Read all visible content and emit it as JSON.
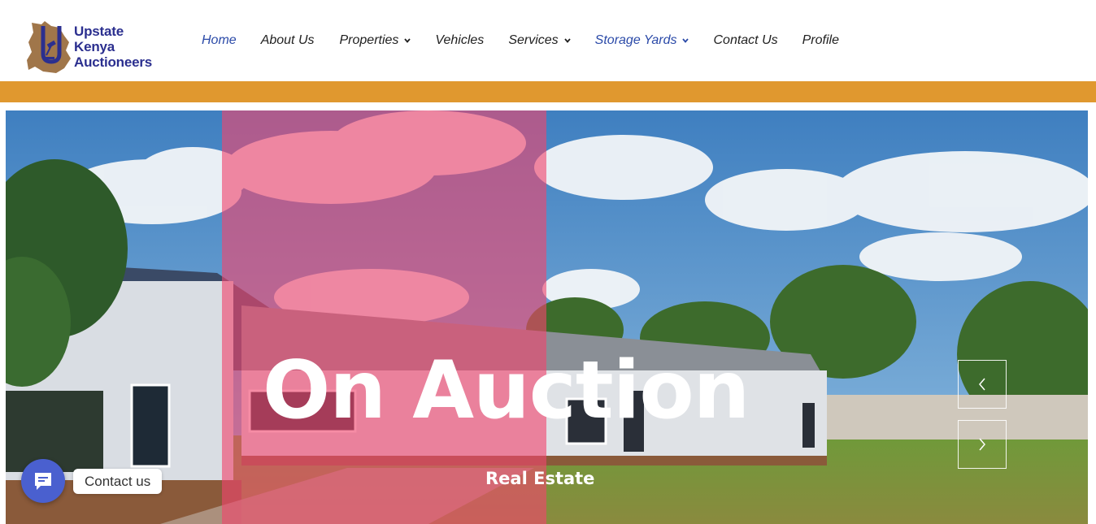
{
  "brand": {
    "line1": "Upstate",
    "line2": "Kenya",
    "line3": "Auctioneers"
  },
  "nav": {
    "items": [
      {
        "label": "Home",
        "active": true,
        "has_dropdown": false
      },
      {
        "label": "About Us",
        "active": false,
        "has_dropdown": false
      },
      {
        "label": "Properties",
        "active": false,
        "has_dropdown": true
      },
      {
        "label": "Vehicles",
        "active": false,
        "has_dropdown": false
      },
      {
        "label": "Services",
        "active": false,
        "has_dropdown": true
      },
      {
        "label": "Storage Yards",
        "active": true,
        "has_dropdown": true
      },
      {
        "label": "Contact Us",
        "active": false,
        "has_dropdown": false
      },
      {
        "label": "Profile",
        "active": false,
        "has_dropdown": false
      }
    ]
  },
  "hero": {
    "headline": "On Auction",
    "subheadline": "Real Estate",
    "prev_icon": "chevron-left-icon",
    "next_icon": "chevron-right-icon"
  },
  "chat": {
    "label": "Contact us",
    "icon": "chat-icon"
  },
  "colors": {
    "accent_band": "#e0982f",
    "brand_blue": "#2b2f8f",
    "overlay_pink": "#f0466e",
    "chat_blue": "#4a60cf"
  }
}
